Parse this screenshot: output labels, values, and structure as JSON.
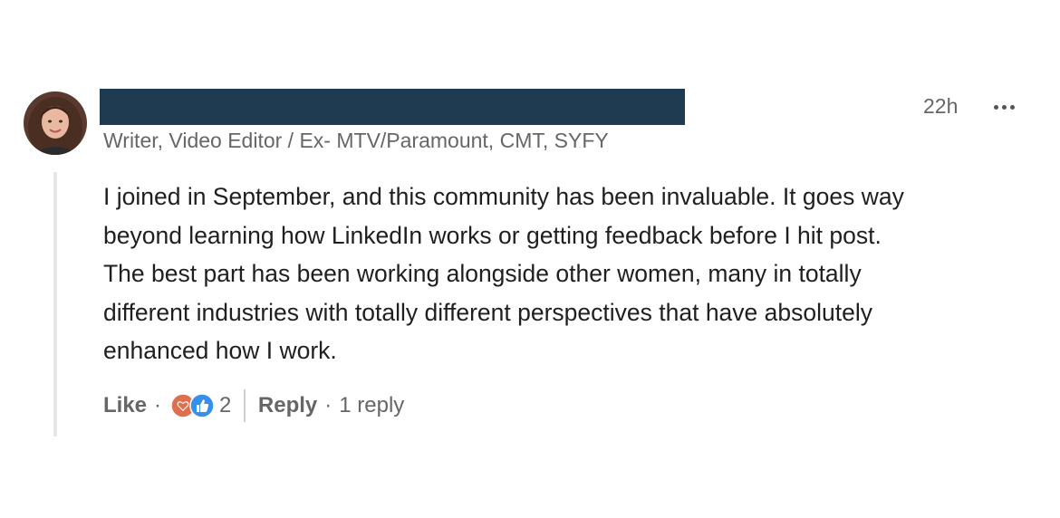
{
  "comment": {
    "author_headline": "Writer, Video Editor / Ex- MTV/Paramount, CMT, SYFY",
    "timestamp": "22h",
    "body_lines": [
      "I joined in September, and this community has been invaluable. It goes way",
      "beyond learning how LinkedIn works or getting feedback before I hit post.",
      "The best part has been working alongside other women, many in totally",
      "different industries with totally different perspectives that have absolutely",
      "enhanced how I work."
    ],
    "icons": {
      "more": "more-options-icon",
      "love": "love-reaction-icon",
      "like": "like-reaction-icon",
      "avatar": "author-avatar"
    },
    "colors": {
      "redaction": "#1f3b52",
      "love_reaction": "#df704d",
      "like_reaction": "#378fe9"
    }
  },
  "actions": {
    "like_label": "Like",
    "separator": "·",
    "reaction_count": "2",
    "reply_label": "Reply",
    "reply_count": "1 reply"
  }
}
